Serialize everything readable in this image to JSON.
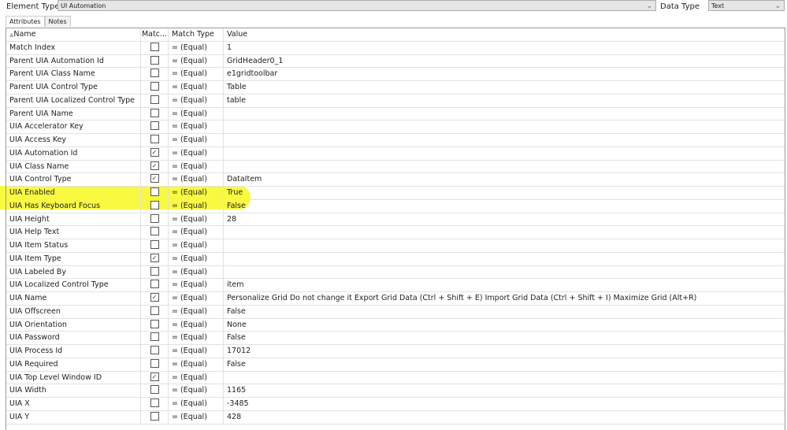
{
  "element_type": {
    "label": "Element Type",
    "value": "UI Automation"
  },
  "data_type": {
    "label": "Data Type",
    "value": "Text"
  },
  "tabs": [
    "Attributes",
    "Notes"
  ],
  "columns": [
    "Name",
    "Matc...",
    "Match Type",
    "Value"
  ],
  "highlight_color": "#f7f700",
  "rows": [
    {
      "name": "Match Index",
      "checked": false,
      "type": "=  (Equal)",
      "value": "1"
    },
    {
      "name": "Parent UIA Automation Id",
      "checked": false,
      "type": "=  (Equal)",
      "value": "GridHeader0_1"
    },
    {
      "name": "Parent UIA Class Name",
      "checked": false,
      "type": "=  (Equal)",
      "value": "e1gridtoolbar"
    },
    {
      "name": "Parent UIA Control Type",
      "checked": false,
      "type": "=  (Equal)",
      "value": "Table"
    },
    {
      "name": "Parent UIA Localized Control Type",
      "checked": false,
      "type": "=  (Equal)",
      "value": "table"
    },
    {
      "name": "Parent UIA Name",
      "checked": false,
      "type": "=  (Equal)",
      "value": ""
    },
    {
      "name": "UIA Accelerator Key",
      "checked": false,
      "type": "=  (Equal)",
      "value": ""
    },
    {
      "name": "UIA Access Key",
      "checked": false,
      "type": "=  (Equal)",
      "value": ""
    },
    {
      "name": "UIA Automation Id",
      "checked": true,
      "type": "=  (Equal)",
      "value": ""
    },
    {
      "name": "UIA Class Name",
      "checked": true,
      "type": "=  (Equal)",
      "value": ""
    },
    {
      "name": "UIA Control Type",
      "checked": true,
      "type": "=  (Equal)",
      "value": "DataItem"
    },
    {
      "name": "UIA Enabled",
      "checked": false,
      "type": "=  (Equal)",
      "value": "True"
    },
    {
      "name": "UIA Has Keyboard Focus",
      "checked": false,
      "type": "=  (Equal)",
      "value": "False"
    },
    {
      "name": "UIA Height",
      "checked": false,
      "type": "=  (Equal)",
      "value": "28"
    },
    {
      "name": "UIA Help Text",
      "checked": false,
      "type": "=  (Equal)",
      "value": ""
    },
    {
      "name": "UIA Item Status",
      "checked": false,
      "type": "=  (Equal)",
      "value": ""
    },
    {
      "name": "UIA Item Type",
      "checked": true,
      "type": "=  (Equal)",
      "value": ""
    },
    {
      "name": "UIA Labeled By",
      "checked": false,
      "type": "=  (Equal)",
      "value": ""
    },
    {
      "name": "UIA Localized Control Type",
      "checked": false,
      "type": "=  (Equal)",
      "value": "item"
    },
    {
      "name": "UIA Name",
      "checked": true,
      "type": "=  (Equal)",
      "value": "Personalize Grid  Do not change it Export Grid Data (Ctrl + Shift + E) Import Grid Data (Ctrl + Shift + I) Maximize Grid (Alt+R)"
    },
    {
      "name": "UIA Offscreen",
      "checked": false,
      "type": "=  (Equal)",
      "value": "False"
    },
    {
      "name": "UIA Orientation",
      "checked": false,
      "type": "=  (Equal)",
      "value": "None"
    },
    {
      "name": "UIA Password",
      "checked": false,
      "type": "=  (Equal)",
      "value": "False"
    },
    {
      "name": "UIA Process Id",
      "checked": false,
      "type": "=  (Equal)",
      "value": "17012"
    },
    {
      "name": "UIA Required",
      "checked": false,
      "type": "=  (Equal)",
      "value": "False"
    },
    {
      "name": "UIA Top Level Window ID",
      "checked": true,
      "type": "=  (Equal)",
      "value": ""
    },
    {
      "name": "UIA Width",
      "checked": false,
      "type": "=  (Equal)",
      "value": "1165"
    },
    {
      "name": "UIA X",
      "checked": false,
      "type": "=  (Equal)",
      "value": "-3485"
    },
    {
      "name": "UIA Y",
      "checked": false,
      "type": "=  (Equal)",
      "value": "428"
    }
  ]
}
